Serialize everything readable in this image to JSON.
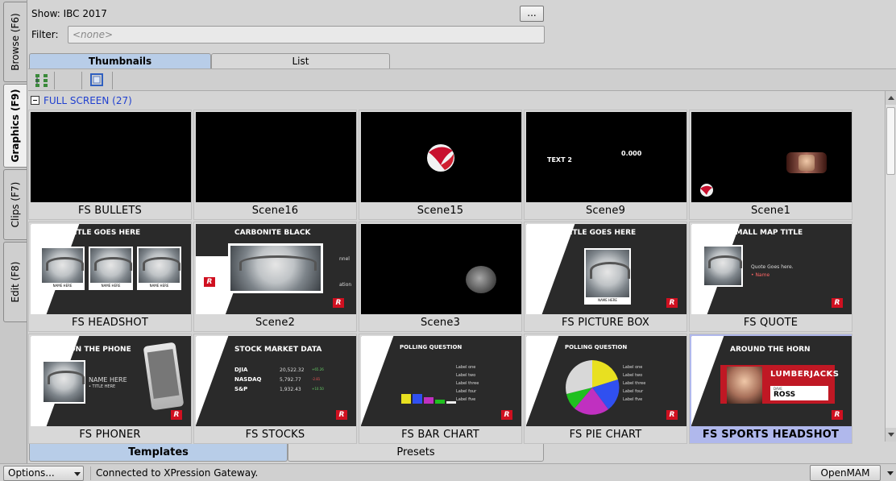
{
  "side_tabs": [
    {
      "label": "Browse (F6)",
      "active": false
    },
    {
      "label": "Graphics (F9)",
      "active": true
    },
    {
      "label": "Clips (F7)",
      "active": false
    },
    {
      "label": "Edit (F8)",
      "active": false
    }
  ],
  "header": {
    "show_label": "Show: IBC 2017",
    "browse_button": "...",
    "filter_label": "Filter:",
    "filter_placeholder": "<none>"
  },
  "view_tabs": {
    "thumbnails": "Thumbnails",
    "list": "List"
  },
  "toolbar": {
    "icons": [
      "tree-view-icon",
      "fullscreen-icon"
    ]
  },
  "group": {
    "title": "FULL SCREEN (27)"
  },
  "tiles": [
    {
      "label": "FS BULLETS"
    },
    {
      "label": "Scene16"
    },
    {
      "label": "Scene15"
    },
    {
      "label": "Scene9",
      "thumb_text_1": "TEXT 2",
      "thumb_text_2": "0.000"
    },
    {
      "label": "Scene1"
    },
    {
      "label": "FS HEADSHOT",
      "thumb_title": "TITLE GOES HERE",
      "caption": "NAME HERE"
    },
    {
      "label": "Scene2",
      "thumb_title": "CARBONITE BLACK",
      "side_text_1": "nnel",
      "side_text_2": "ation"
    },
    {
      "label": "Scene3"
    },
    {
      "label": "FS PICTURE BOX",
      "thumb_title": "TITLE GOES HERE",
      "caption": "NAME HERE"
    },
    {
      "label": "FS QUOTE",
      "thumb_title": "SMALL MAP TITLE",
      "quote": "Quote Goes here.",
      "name": "• Name"
    },
    {
      "label": "FS PHONER",
      "thumb_title": "ON THE PHONE",
      "name": "NAME HERE",
      "subtitle": "• TITLE HERE"
    },
    {
      "label": "FS STOCKS",
      "thumb_title": "STOCK MARKET DATA",
      "rows": [
        {
          "name": "DJIA",
          "value": "20,522.32",
          "change": "+65.26"
        },
        {
          "name": "NASDAQ",
          "value": "5,792.77",
          "change": "-2.81"
        },
        {
          "name": "S&P",
          "value": "1,932.43",
          "change": "+10.50"
        }
      ]
    },
    {
      "label": "FS BAR CHART",
      "thumb_title": "POLLING QUESTION",
      "legend": [
        "Label one",
        "Label two",
        "Label three",
        "Label four",
        "Label five"
      ]
    },
    {
      "label": "FS PIE CHART",
      "thumb_title": "POLLING QUESTION",
      "legend": [
        "Label one",
        "Label two",
        "Label three",
        "Label four",
        "Label five"
      ]
    },
    {
      "label": "FS SPORTS HEADSHOT",
      "thumb_title": "AROUND THE HORN",
      "team": "LUMBERJACKS",
      "first": "DAVE",
      "last": "ROSS",
      "selected": true
    }
  ],
  "bottom_tabs": {
    "templates": "Templates",
    "presets": "Presets"
  },
  "status": {
    "options_label": "Options...",
    "connection": "Connected to XPression Gateway.",
    "mam_label": "OpenMAM"
  },
  "colors": {
    "accent_tab": "#b8cde8",
    "selected_tile": "#b0b8ec",
    "group_link": "#2040d0",
    "brand_red": "#d01020"
  }
}
